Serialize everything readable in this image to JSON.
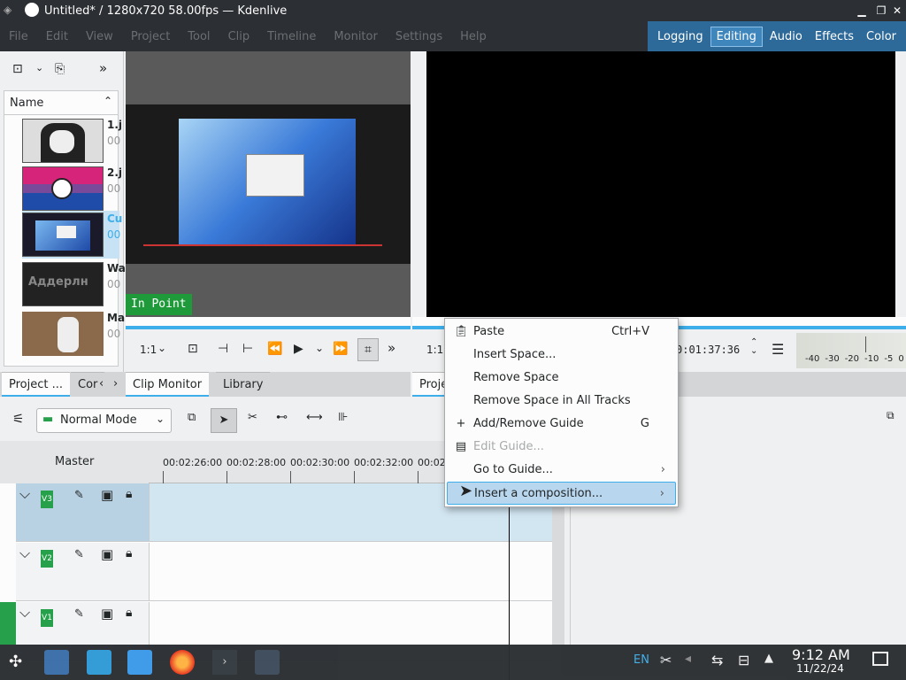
{
  "window": {
    "title": "Untitled* / 1280x720 58.00fps — Kdenlive"
  },
  "menu": [
    "File",
    "Edit",
    "View",
    "Project",
    "Tool",
    "Clip",
    "Timeline",
    "Monitor",
    "Settings",
    "Help"
  ],
  "workspaces": [
    {
      "label": "Logging",
      "active": false
    },
    {
      "label": "Editing",
      "active": true
    },
    {
      "label": "Audio",
      "active": false
    },
    {
      "label": "Effects",
      "active": false
    },
    {
      "label": "Color",
      "active": false
    }
  ],
  "bin": {
    "header": "Name",
    "clips": [
      {
        "name": "1.j",
        "sub": "00"
      },
      {
        "name": "2.j",
        "sub": "00"
      },
      {
        "name": "Cu",
        "sub": "00"
      },
      {
        "name": "Wa",
        "sub": "00"
      },
      {
        "name": "Ma",
        "sub": "00"
      }
    ],
    "thumb_text": "Аддерлн"
  },
  "clip_monitor": {
    "in_point": "In Point",
    "zoom": "1:1"
  },
  "project_monitor": {
    "zoom": "1:1",
    "timecode": "0:01:37:36"
  },
  "tabs_left": [
    "Project ...",
    "Cor"
  ],
  "tabs_mid": [
    "Clip Monitor",
    "Library"
  ],
  "tabs_right": [
    "Proje"
  ],
  "audio_meter": [
    "-40",
    "-30",
    "-20",
    "-10",
    "-5",
    "0"
  ],
  "context_menu": [
    {
      "label": "Paste",
      "shortcut": "Ctrl+V",
      "icon": "paste",
      "disabled": false,
      "submenu": false,
      "highlighted": false
    },
    {
      "label": "Insert Space...",
      "shortcut": "",
      "icon": "",
      "disabled": false,
      "submenu": false,
      "highlighted": false
    },
    {
      "label": "Remove Space",
      "shortcut": "",
      "icon": "",
      "disabled": false,
      "submenu": false,
      "highlighted": false
    },
    {
      "label": "Remove Space in All Tracks",
      "shortcut": "",
      "icon": "",
      "disabled": false,
      "submenu": false,
      "highlighted": false
    },
    {
      "label": "Add/Remove Guide",
      "shortcut": "G",
      "icon": "plus",
      "disabled": false,
      "submenu": false,
      "highlighted": false
    },
    {
      "label": "Edit Guide...",
      "shortcut": "",
      "icon": "edit",
      "disabled": true,
      "submenu": false,
      "highlighted": false
    },
    {
      "label": "Go to Guide...",
      "shortcut": "",
      "icon": "",
      "disabled": false,
      "submenu": true,
      "highlighted": false
    },
    {
      "label": "Insert a composition...",
      "shortcut": "",
      "icon": "",
      "disabled": false,
      "submenu": true,
      "highlighted": true
    }
  ],
  "timeline": {
    "mode": "Normal Mode",
    "master_label": "Master",
    "ruler": [
      "00:02:26:00",
      "00:02:28:00",
      "00:02:30:00",
      "00:02:32:00",
      "00:02"
    ],
    "tracks": [
      {
        "tag": "V3",
        "selected": true
      },
      {
        "tag": "V2",
        "selected": false
      },
      {
        "tag": "V1",
        "selected": false
      }
    ]
  },
  "taskbar": {
    "lang": "EN",
    "time": "9:12 AM",
    "date": "11/22/24"
  }
}
